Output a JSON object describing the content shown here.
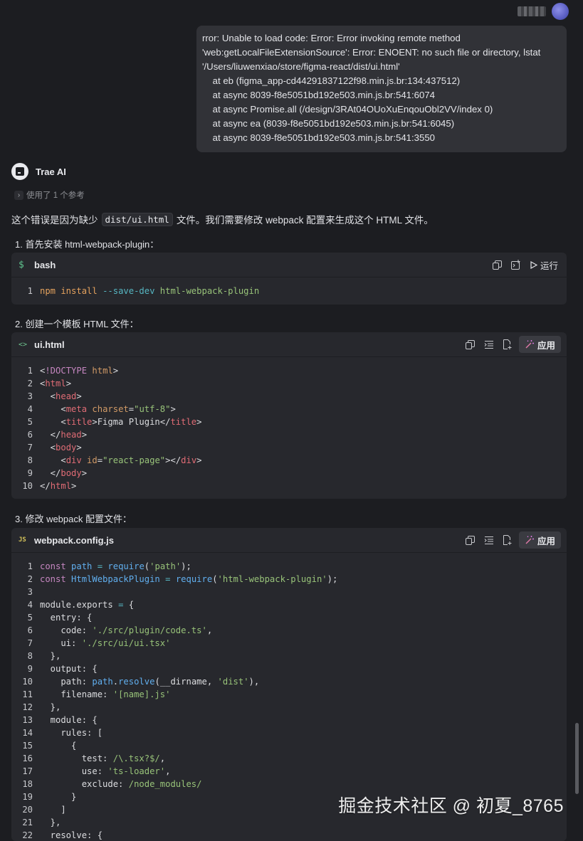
{
  "user_message": {
    "lines": [
      "rror: Unable to load code: Error: Error invoking remote method",
      "'web:getLocalFileExtensionSource': Error: ENOENT: no such file or directory, lstat",
      "'/Users/liuwenxiao/store/figma-react/dist/ui.html'",
      "    at eb (figma_app-cd44291837122f98.min.js.br:134:437512)",
      "    at async 8039-f8e5051bd192e503.min.js.br:541:6074",
      "    at async Promise.all (/design/3RAt04OUoXuEnqouObl2VV/index 0)",
      "    at async ea (8039-f8e5051bd192e503.min.js.br:541:6045)",
      "    at async 8039-f8e5051bd192e503.min.js.br:541:3550"
    ]
  },
  "assistant": {
    "name": "Trae AI",
    "reference_label": "使用了 1 个参考",
    "intro_before": "这个错误是因为缺少",
    "intro_code": "dist/ui.html",
    "intro_after": "文件。我们需要修改 webpack 配置来生成这个 HTML 文件。"
  },
  "steps": {
    "step1": "1. 首先安装 html-webpack-plugin：",
    "step2": "2. 创建一个模板 HTML 文件：",
    "step3": "3. 修改 webpack 配置文件："
  },
  "blocks": {
    "bash": {
      "title": "bash",
      "icon": "dollar-icon",
      "run_label": "运行",
      "line_number": "1",
      "cmd": "npm install",
      "flag": "--save-dev",
      "arg": "html-webpack-plugin"
    },
    "html": {
      "title": "ui.html",
      "icon": "code-brackets-icon",
      "apply_label": "应用"
    },
    "js": {
      "title": "webpack.config.js",
      "icon": "js-file-icon",
      "icon_text": "JS",
      "apply_label": "应用"
    }
  },
  "watermark": "掘金技术社区 @ 初夏_8765",
  "colors": {
    "background": "#1c1d21",
    "panel": "#27282d",
    "user_bubble": "#313237"
  }
}
